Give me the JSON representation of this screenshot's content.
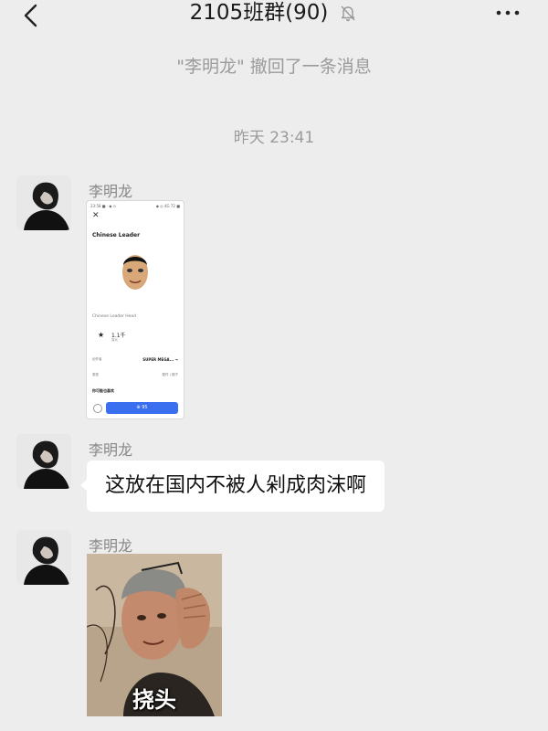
{
  "header": {
    "title": "2105班群(90)",
    "back_icon": "chevron-left-icon",
    "mute_icon": "bell-off-icon",
    "more_icon": "more-horizontal-icon"
  },
  "system": {
    "recall_notice": "\"李明龙\" 撤回了一条消息",
    "timestamp": "昨天 23:41"
  },
  "messages": [
    {
      "sender": "李明龙",
      "type": "image",
      "screenshot": {
        "status_left": "23:58 ■ · ◆ ⊙",
        "status_right": "◆ ◎ 4G 72 ■",
        "title": "Chinese Leader",
        "head_label": "Chinese Leader Head",
        "count": "1.1千",
        "count_sub": "喜欢",
        "row1_left": "创作者",
        "row1_right": "SUPER MEGA... →",
        "row2_left": "类型",
        "row2_right": "配件 | 帽子",
        "fav_label": "你可能也喜欢",
        "button_label": "⊕ 95"
      }
    },
    {
      "sender": "李明龙",
      "type": "text",
      "text": "这放在国内不被人剁成肉沫啊"
    },
    {
      "sender": "李明龙",
      "type": "sticker",
      "caption": "挠头"
    }
  ]
}
